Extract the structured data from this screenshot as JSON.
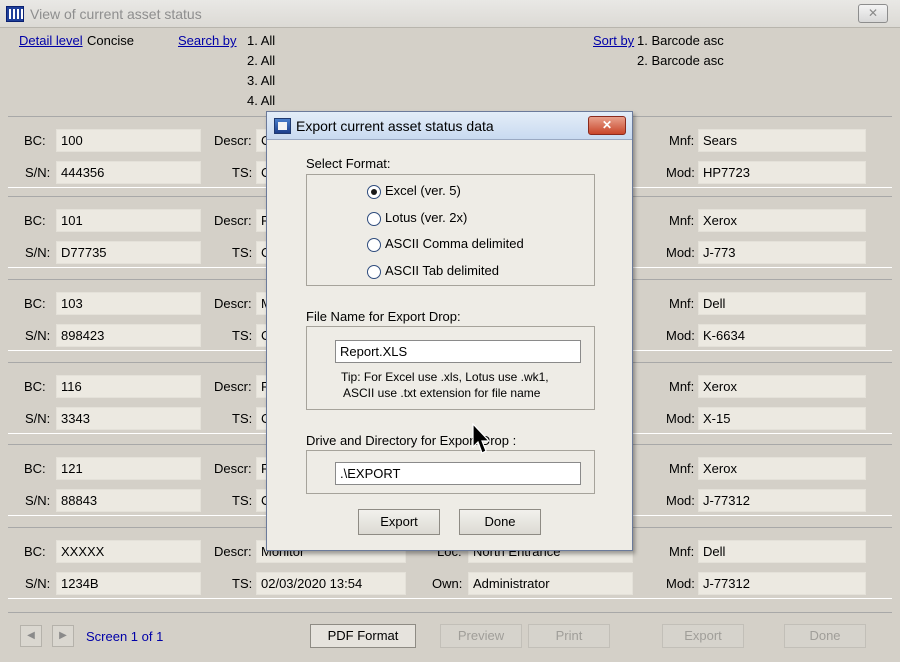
{
  "window": {
    "title": "View of current asset status",
    "close_glyph": "✕"
  },
  "header": {
    "detail_level_label": "Detail level",
    "detail_level_value": "Concise",
    "search_by_label": "Search by",
    "search_by_values": [
      "1. All",
      "2. All",
      "3. All",
      "4. All"
    ],
    "sort_by_label": "Sort by",
    "sort_by_values": [
      "1. Barcode asc",
      "2. Barcode asc"
    ]
  },
  "field_labels": {
    "bc": "BC:",
    "descr": "Descr:",
    "loc": "Loc:",
    "mnf": "Mnf:",
    "sn": "S/N:",
    "ts": "TS:",
    "own": "Own:",
    "mod": "Mod:"
  },
  "records": [
    {
      "bc": "100",
      "sn": "444356",
      "descr": "C",
      "ts": "C",
      "mnf": "Sears",
      "mod": "HP7723"
    },
    {
      "bc": "101",
      "sn": "D77735",
      "descr": "F",
      "ts": "C",
      "mnf": "Xerox",
      "mod": "J-773"
    },
    {
      "bc": "103",
      "sn": "898423",
      "descr": "M",
      "ts": "C",
      "mnf": "Dell",
      "mod": "K-6634"
    },
    {
      "bc": "116",
      "sn": "3343",
      "descr": "F",
      "ts": "C",
      "mnf": "Xerox",
      "mod": "X-15"
    },
    {
      "bc": "121",
      "sn": "88843",
      "descr": "F",
      "ts": "C",
      "mnf": "Xerox",
      "mod": "J-77312"
    },
    {
      "bc": "XXXXX",
      "sn": "1234B",
      "descr": "Monitor",
      "ts": "02/03/2020 13:54",
      "loc": "North Entrance",
      "own": "Administrator",
      "mnf": "Dell",
      "mod": "J-77312"
    }
  ],
  "footer": {
    "prev_glyph": "◀",
    "next_glyph": "▶",
    "screen_text": "Screen 1 of 1",
    "pdf_label": "PDF Format",
    "preview_label": "Preview",
    "print_label": "Print",
    "export_label": "Export",
    "done_label": "Done"
  },
  "dialog": {
    "title": "Export current asset status data",
    "close_glyph": "✕",
    "select_format_label": "Select Format:",
    "formats": [
      "Excel (ver. 5)",
      "Lotus (ver. 2x)",
      "ASCII Comma delimited",
      "ASCII Tab delimited"
    ],
    "selected_format": "Excel (ver. 5)",
    "file_name_label": "File Name for Export Drop:",
    "file_name_value": "Report.XLS",
    "tip_line1": "Tip: For Excel use .xls, Lotus use .wk1,",
    "tip_line2": "ASCII use .txt extension for file name",
    "drive_label": "Drive and Directory for Export Drop :",
    "drive_value": ".\\EXPORT",
    "export_label": "Export",
    "done_label": "Done"
  },
  "icons": [
    "app-icon",
    "dialog-icon",
    "mouse-pointer-icon"
  ]
}
